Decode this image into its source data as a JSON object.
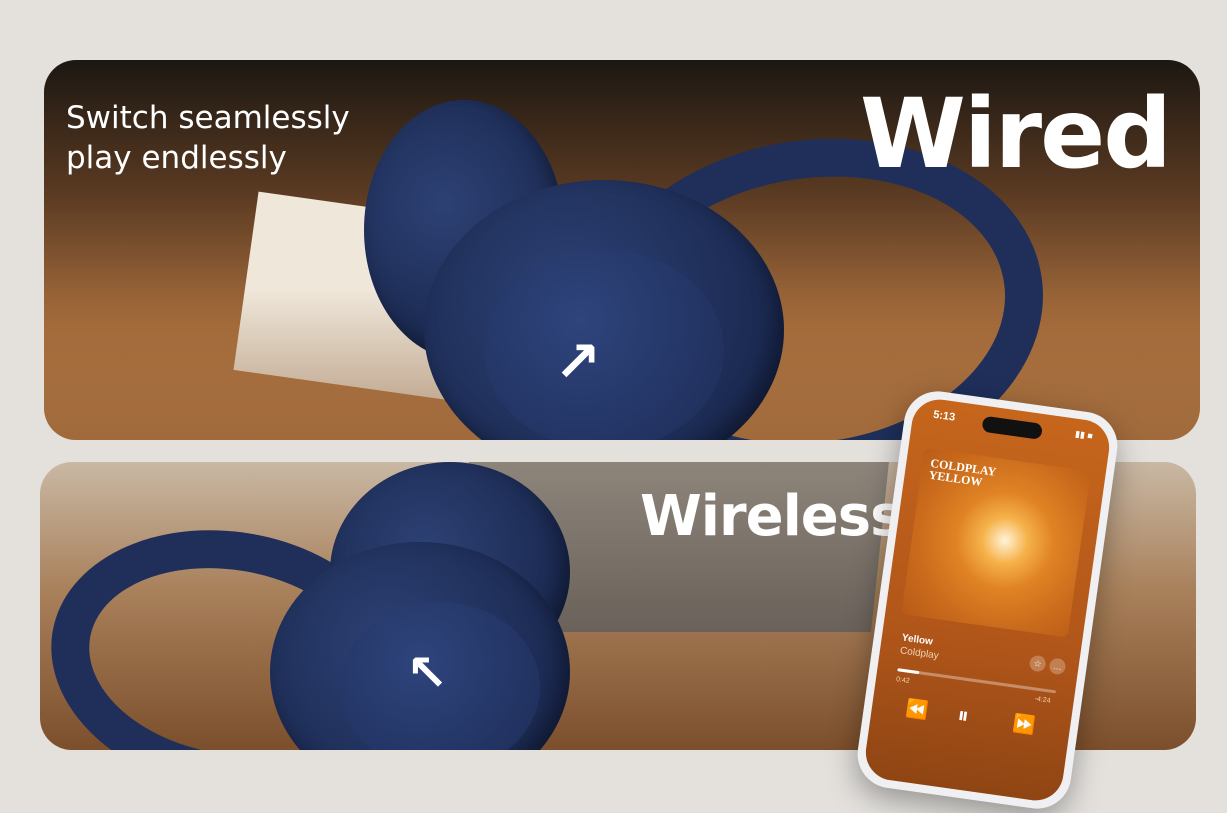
{
  "banner": {
    "tagline_line1": "Switch seamlessly",
    "tagline_line2": "play endlessly",
    "wired_label": "Wired",
    "wireless_label": "Wireless"
  },
  "phone": {
    "clock": "5:13",
    "album_art_text": "COLDPLAY\nYELLOW",
    "track_title": "Yellow",
    "track_artist": "Coldplay",
    "time_elapsed": "0:42",
    "time_remaining": "-4:24",
    "progress_fraction": 0.14
  },
  "colors": {
    "background": "#e4e1dd",
    "headphone_blue": "#1f2f5a",
    "phone_screen": "#c6661c",
    "text": "#ffffff"
  },
  "icons": {
    "logo": "arrow-logo-icon",
    "favorite": "star-icon",
    "more": "ellipsis-icon",
    "previous": "rewind-icon",
    "pause": "pause-icon",
    "next": "fast-forward-icon"
  }
}
